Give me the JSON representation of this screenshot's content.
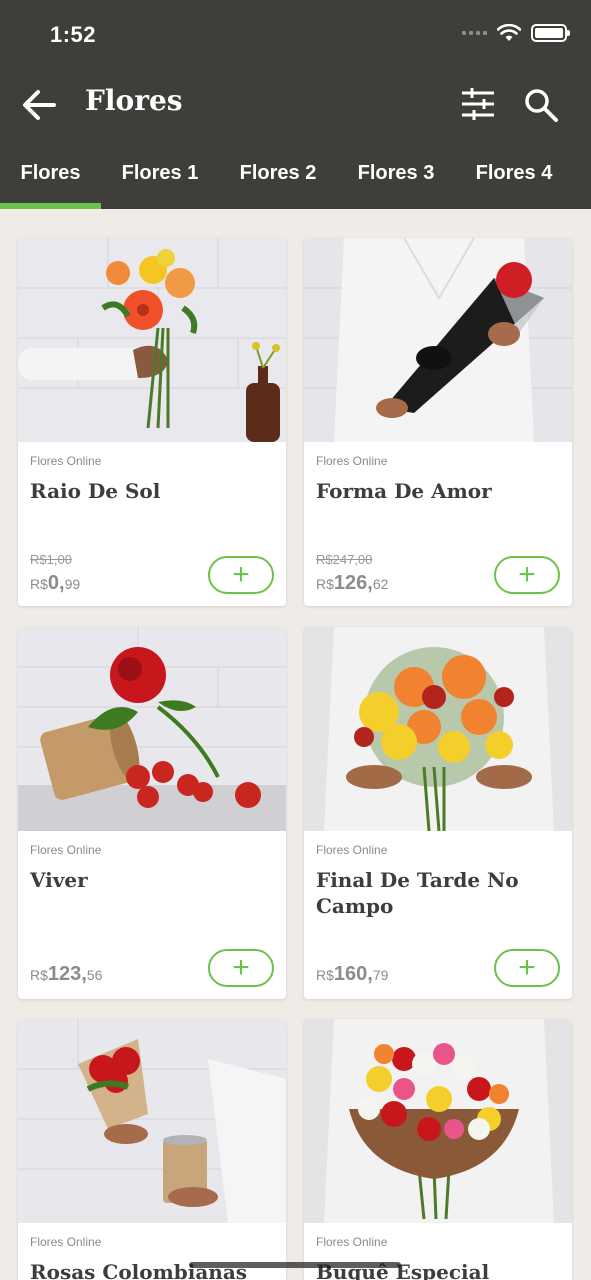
{
  "status_bar": {
    "time": "1:52"
  },
  "appbar": {
    "title": "Flores"
  },
  "tabs": [
    {
      "label": "Flores"
    },
    {
      "label": "Flores 1"
    },
    {
      "label": "Flores 2"
    },
    {
      "label": "Flores 3"
    },
    {
      "label": "Flores 4"
    }
  ],
  "colors": {
    "accent": "#6cc24a",
    "header": "#3f3e3a",
    "background": "#efece8"
  },
  "products": [
    {
      "brand": "Flores Online",
      "name": "Raio De Sol",
      "old_price": "R$1,00",
      "currency": "R$",
      "price_int": "0,",
      "price_dec": "99",
      "add_label": "+"
    },
    {
      "brand": "Flores Online",
      "name": "Forma De Amor",
      "old_price": "R$247,00",
      "currency": "R$",
      "price_int": "126,",
      "price_dec": "62",
      "add_label": "+"
    },
    {
      "brand": "Flores Online",
      "name": "Viver",
      "old_price": "",
      "currency": "R$",
      "price_int": "123,",
      "price_dec": "56",
      "add_label": "+"
    },
    {
      "brand": "Flores Online",
      "name": "Final De Tarde No Campo",
      "old_price": "",
      "currency": "R$",
      "price_int": "160,",
      "price_dec": "79",
      "add_label": "+"
    },
    {
      "brand": "Flores Online",
      "name": "Rosas Colombianas Com",
      "old_price": "",
      "currency": "",
      "price_int": "",
      "price_dec": "",
      "add_label": ""
    },
    {
      "brand": "Flores Online",
      "name": "Buquê Especial",
      "old_price": "",
      "currency": "",
      "price_int": "",
      "price_dec": "",
      "add_label": ""
    }
  ]
}
